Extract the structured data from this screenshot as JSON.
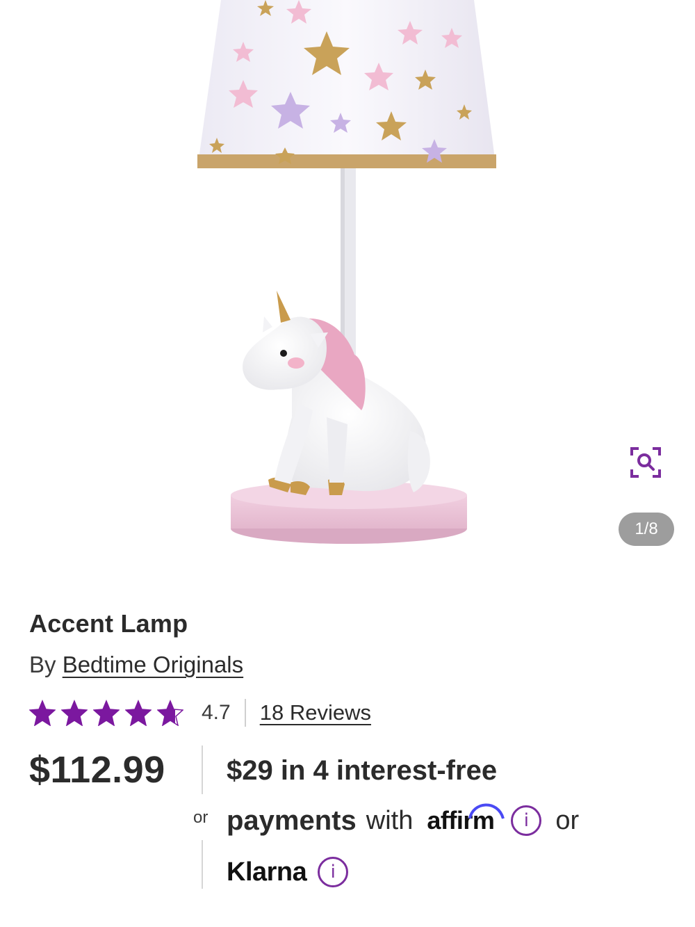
{
  "gallery": {
    "image_alt": "Unicorn lamp with star print shade",
    "counter": "1/8",
    "zoom_icon": "zoom-search-icon"
  },
  "product": {
    "title": "Accent Lamp",
    "by_prefix": "By",
    "brand": "Bedtime Originals",
    "rating": 4.7,
    "rating_text": "4.7",
    "star_count": 5,
    "reviews_text": "18 Reviews",
    "price": "$112.99"
  },
  "payments": {
    "or_small": "or",
    "line1": "$29 in 4 interest-free",
    "line2_bold": "payments",
    "with": "with",
    "affirm_logo": "affirm",
    "or_end": "or",
    "klarna_logo": "Klarna",
    "info_icon": "info-icon"
  },
  "colors": {
    "accent_purple": "#7b2d9e",
    "star_purple": "#7b189f",
    "counter_bg": "#9d9d9d",
    "text": "#2b2b2b"
  }
}
